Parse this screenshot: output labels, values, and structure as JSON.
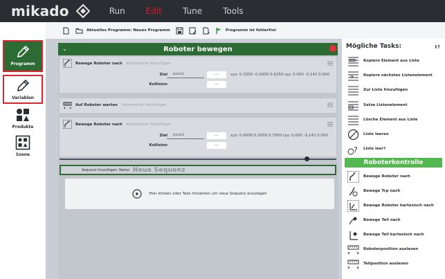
{
  "app": {
    "logo_text": "mikado",
    "nav": [
      {
        "label": "Run",
        "active": false
      },
      {
        "label": "Edit",
        "active": true
      },
      {
        "label": "Tune",
        "active": false
      },
      {
        "label": "Tools",
        "active": false
      }
    ],
    "colors": {
      "brand_green": "#2d6b35",
      "accent_green": "#54b850",
      "active_red": "#e8142a",
      "highlight_red": "#e2202e"
    }
  },
  "sidebar": {
    "items": [
      {
        "label": "Programm",
        "icon": "pencil-icon",
        "active": true
      },
      {
        "label": "Variablen",
        "icon": "pencil-icon",
        "active": false
      },
      {
        "label": "Produkte",
        "icon": "shapes-icon",
        "active": false
      },
      {
        "label": "Szene",
        "icon": "scene-icon",
        "active": false
      }
    ]
  },
  "toolbar": {
    "program_text": "Aktuelles Programm: Neues Programm",
    "error_text": "Programm ist fehlerfrei"
  },
  "editor": {
    "title": "Roboter bewegen",
    "tasks": [
      {
        "name": "Bewege Roboter nach",
        "comment_placeholder": "Kommentar hinzufügen",
        "params": [
          {
            "label": "Ziel",
            "value": "pose1",
            "button": "...",
            "info": "xyz: 0.3350 -0.0000 0.6250 rpy: 0.000 -3.142 0.000"
          },
          {
            "label": "Kollision",
            "button": "..."
          }
        ]
      },
      {
        "name": "Auf Roboter warten",
        "comment_placeholder": "Kommentar hinzufügen"
      },
      {
        "name": "Bewege Roboter nach",
        "comment_placeholder": "Kommentar hinzufügen",
        "params": [
          {
            "label": "Ziel",
            "value": "pose2",
            "button": "...",
            "info": "xyz: 0.4000 0.2000 0.7000 rpy: 0.000 -3.142 0.000"
          },
          {
            "label": "Kollision",
            "button": "..."
          }
        ]
      }
    ],
    "sequence": {
      "label": "Sequenz hinzufügen. Name",
      "name_placeholder": "Neue Sequenz"
    },
    "drop_zone_text": "Hier klicken oder Task hinziehen um neue Sequenz anzulegen"
  },
  "tasks_panel": {
    "title": "Mögliche Tasks:",
    "sort_label": "I↑",
    "list_items": [
      "Kopiere Element aus Liste",
      "Kopiere nächstes Listenelement",
      "Zur Liste hinzufügen",
      "Setze Listenelement",
      "Lösche Element aus Liste",
      "Liste leeren",
      "Liste leer?"
    ],
    "section_title": "Roboterkontrolle",
    "robot_items": [
      "Bewege Roboter nach",
      "Bewege Tcp nach",
      "Bewege Roboter kartesisch nach",
      "Bewege Teil nach",
      "Bewege Teil kartesisch nach",
      "Roboterposition auslesen",
      "Teilposition auslesen"
    ]
  }
}
